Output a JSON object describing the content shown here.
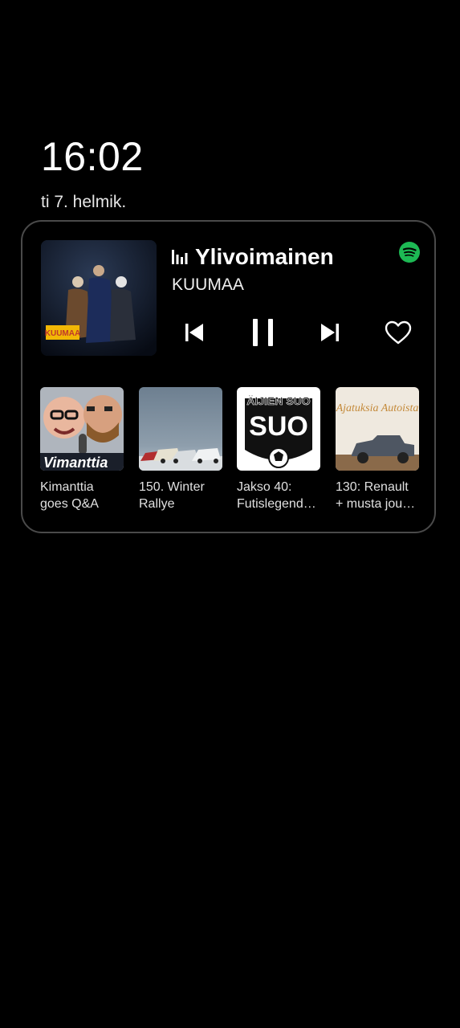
{
  "lockscreen": {
    "time": "16:02",
    "date": "ti 7. helmik."
  },
  "player": {
    "track_title": "Ylivoimainen",
    "artist": "KUUMAA",
    "album_art_text": "KUUMAA",
    "app_icon": "spotify-icon",
    "accent_color": "#1DB954",
    "controls": {
      "prev_icon": "skip-previous-icon",
      "pause_icon": "pause-icon",
      "next_icon": "skip-next-icon",
      "like_icon": "heart-outline-icon"
    }
  },
  "recommendations": [
    {
      "line1": "Kimanttia",
      "line2": "goes Q&A",
      "thumb_text": "Vimanttia"
    },
    {
      "line1": "150. Winter",
      "line2": "Rallye"
    },
    {
      "line1": "Jakso 40:",
      "line2": "Futislegend…",
      "thumb_text": "ÄIJIEN SUO"
    },
    {
      "line1": "130: Renault",
      "line2": "+ musta jou…",
      "thumb_text": "Ajatuksia Autoista"
    }
  ]
}
